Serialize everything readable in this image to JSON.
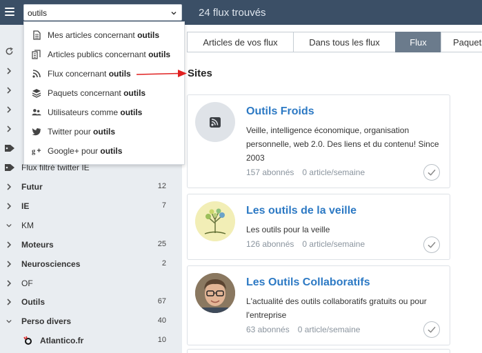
{
  "search": {
    "value": "outils"
  },
  "results_count": "24 flux trouvés",
  "dropdown": {
    "items": [
      {
        "icon": "document-icon",
        "prefix": "Mes articles concernant ",
        "term": "outils"
      },
      {
        "icon": "documents-icon",
        "prefix": "Articles publics concernant ",
        "term": "outils"
      },
      {
        "icon": "rss-icon",
        "prefix": "Flux concernant ",
        "term": "outils"
      },
      {
        "icon": "layers-icon",
        "prefix": "Paquets concernant ",
        "term": "outils"
      },
      {
        "icon": "users-icon",
        "prefix": "Utilisateurs comme ",
        "term": "outils"
      },
      {
        "icon": "twitter-icon",
        "prefix": "Twitter pour ",
        "term": "outils"
      },
      {
        "icon": "google-plus-icon",
        "prefix": "Google+ pour ",
        "term": "outils"
      }
    ]
  },
  "sidebar": {
    "items": [
      {
        "label": "Flux filtré twitter IE",
        "bold": false,
        "count": "",
        "icon": "tag-icon"
      },
      {
        "label": "Futur",
        "bold": true,
        "count": "12",
        "icon": "chevron-right-icon"
      },
      {
        "label": "IE",
        "bold": true,
        "count": "7",
        "icon": "chevron-right-icon"
      },
      {
        "label": "KM",
        "bold": false,
        "count": "",
        "icon": "chevron-down-icon"
      },
      {
        "label": "Moteurs",
        "bold": true,
        "count": "25",
        "icon": "chevron-right-icon"
      },
      {
        "label": "Neurosciences",
        "bold": true,
        "count": "2",
        "icon": "chevron-right-icon"
      },
      {
        "label": "OF",
        "bold": false,
        "count": "",
        "icon": "chevron-right-icon"
      },
      {
        "label": "Outils",
        "bold": true,
        "count": "67",
        "icon": "chevron-right-icon"
      },
      {
        "label": "Perso divers",
        "bold": true,
        "count": "40",
        "icon": "chevron-down-icon"
      },
      {
        "label": "Atlantico.fr",
        "bold": true,
        "count": "10",
        "icon": "atlantico-favicon"
      }
    ]
  },
  "tabs": [
    {
      "label": "Articles de vos flux",
      "active": false
    },
    {
      "label": "Dans tous les flux",
      "active": false
    },
    {
      "label": "Flux",
      "active": true
    },
    {
      "label": "Paquets",
      "active": false
    }
  ],
  "section_title": "Sites",
  "cards": [
    {
      "title": "Outils Froids",
      "description": "Veille, intelligence économique, organisation personnelle, web 2.0. Des liens et du contenu! Since 2003",
      "subscribers": "157 abonnés",
      "rate": "0 article/semaine",
      "avatar": "rss-avatar-icon"
    },
    {
      "title": "Les outils de la veille",
      "description": "Les outils pour la veille",
      "subscribers": "126 abonnés",
      "rate": "0 article/semaine",
      "avatar": "tree-logo"
    },
    {
      "title": "Les Outils Collaboratifs",
      "description": "L'actualité des outils collaboratifs gratuits ou pour l'entreprise",
      "subscribers": "63 abonnés",
      "rate": "0 article/semaine",
      "avatar": "person-photo"
    }
  ],
  "colors": {
    "topbar": "#3b4f66",
    "sidebar": "#e9edf1",
    "link": "#2c79c4",
    "active_tab": "#6b7b8c",
    "annotation_arrow": "#e02020"
  }
}
